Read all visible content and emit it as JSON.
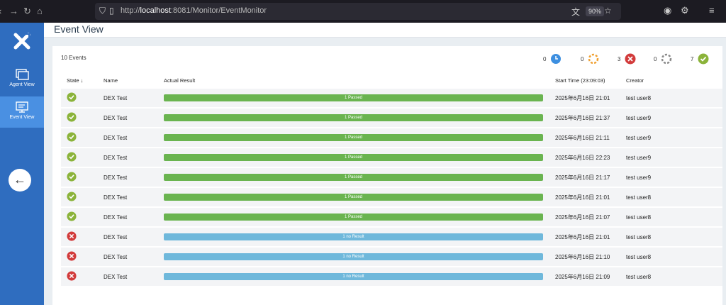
{
  "browser": {
    "url_prefix": "http://",
    "url_host": "localhost",
    "url_rest": ":8081/Monitor/EventMonitor",
    "zoom": "90%"
  },
  "sidebar": {
    "items": [
      {
        "label": "Agent View"
      },
      {
        "label": "Event View"
      }
    ]
  },
  "header": {
    "title": "Event View"
  },
  "summary": {
    "events_count": "10 Events",
    "stats": [
      {
        "count": "0",
        "icon": "pending-clock-icon",
        "color": "#3d8fe0"
      },
      {
        "count": "0",
        "icon": "running-spinner-orange-icon",
        "color": "#f0a030"
      },
      {
        "count": "3",
        "icon": "failed-x-icon",
        "color": "#d23b3b"
      },
      {
        "count": "0",
        "icon": "spinner-gray-icon",
        "color": "#999999"
      },
      {
        "count": "7",
        "icon": "passed-check-icon",
        "color": "#8bb33a"
      }
    ]
  },
  "table": {
    "headers": {
      "state": "State",
      "name": "Name",
      "result": "Actual Result",
      "start": "Start Time (23:09:03)",
      "creator": "Creator"
    },
    "rows": [
      {
        "state": "passed",
        "name": "DEX Test",
        "result": "1 Passed",
        "start": "2025年6月16日 21:01",
        "creator": "test user8"
      },
      {
        "state": "passed",
        "name": "DEX Test",
        "result": "1 Passed",
        "start": "2025年6月16日 21:37",
        "creator": "test user9"
      },
      {
        "state": "passed",
        "name": "DEX Test",
        "result": "1 Passed",
        "start": "2025年6月16日 21:11",
        "creator": "test user9"
      },
      {
        "state": "passed",
        "name": "DEX Test",
        "result": "1 Passed",
        "start": "2025年6月16日 22:23",
        "creator": "test user9"
      },
      {
        "state": "passed",
        "name": "DEX Test",
        "result": "1 Passed",
        "start": "2025年6月16日 21:17",
        "creator": "test user9"
      },
      {
        "state": "passed",
        "name": "DEX Test",
        "result": "1 Passed",
        "start": "2025年6月16日 21:01",
        "creator": "test user8"
      },
      {
        "state": "passed",
        "name": "DEX Test",
        "result": "1 Passed",
        "start": "2025年6月16日 21:07",
        "creator": "test user8"
      },
      {
        "state": "failed",
        "name": "DEX Test",
        "result": "1 no Result",
        "start": "2025年6月16日 21:01",
        "creator": "test user8"
      },
      {
        "state": "failed",
        "name": "DEX Test",
        "result": "1 no Result",
        "start": "2025年6月16日 21:10",
        "creator": "test user8"
      },
      {
        "state": "failed",
        "name": "DEX Test",
        "result": "1 no Result",
        "start": "2025年6月16日 21:09",
        "creator": "test user8"
      }
    ]
  },
  "colors": {
    "sidebar": "#2f6dbf",
    "active": "#4a90e2",
    "passed_bar": "#6ab450",
    "noresult_bar": "#6fb8db",
    "passed_icon": "#8bb33a",
    "failed_icon": "#d23b3b"
  }
}
